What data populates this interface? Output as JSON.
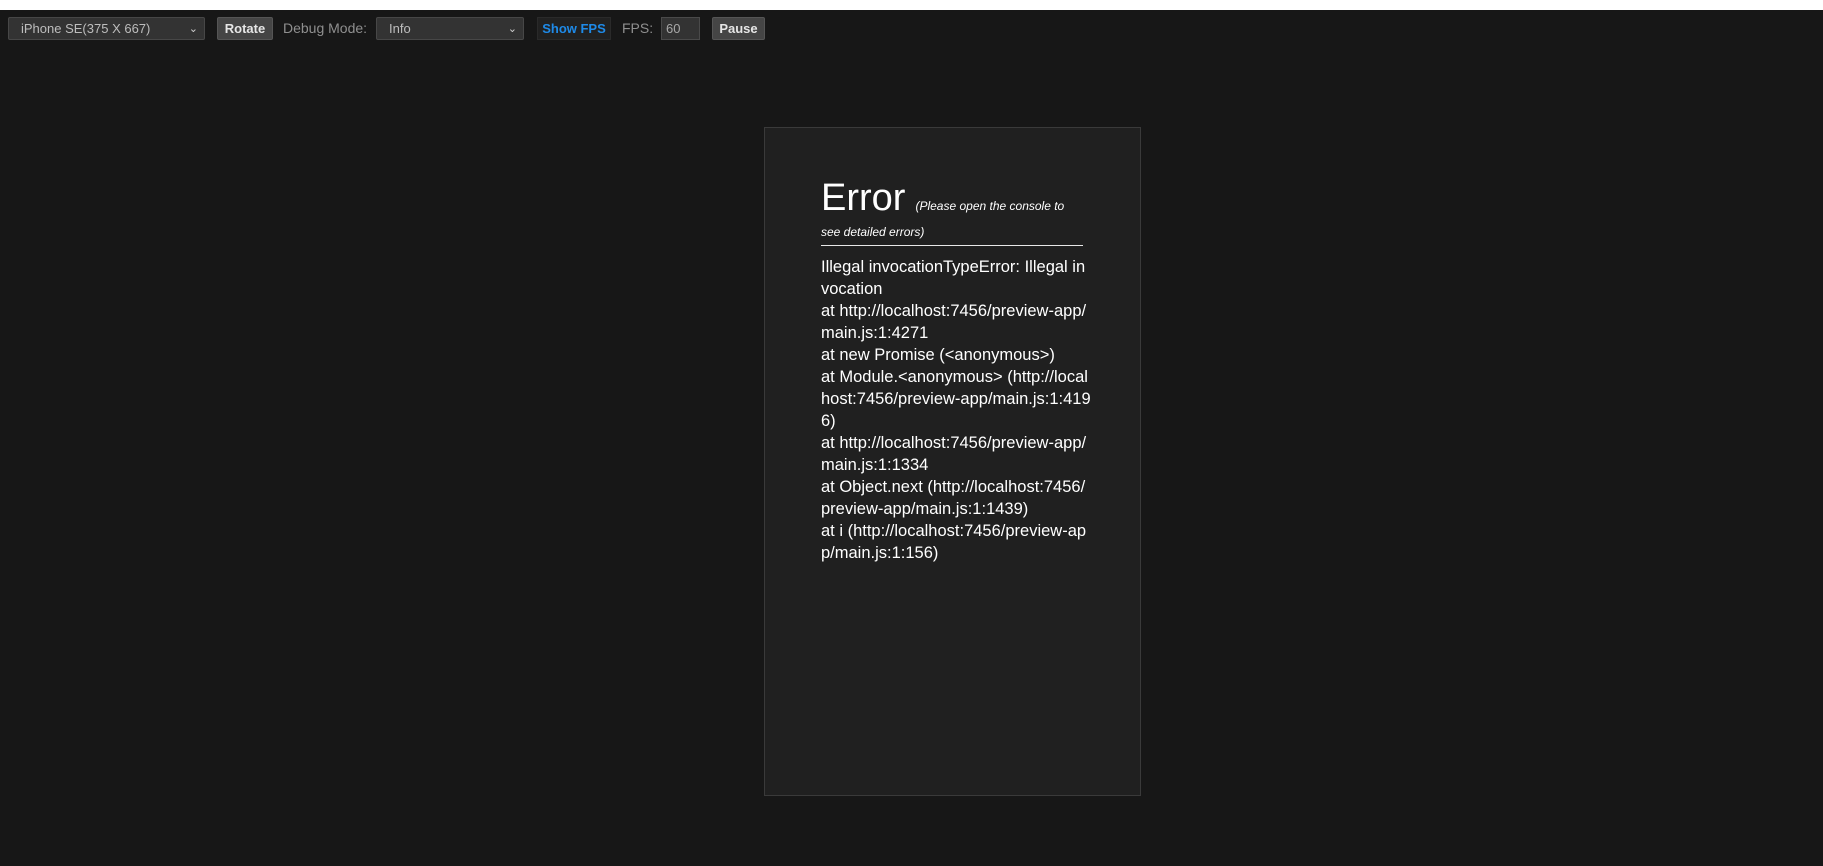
{
  "toolbar": {
    "device_select": "iPhone SE(375 X 667)",
    "rotate_label": "Rotate",
    "debug_mode_label": "Debug Mode:",
    "debug_mode_value": "Info",
    "show_fps_label": "Show FPS",
    "fps_label": "FPS:",
    "fps_value": "60",
    "pause_label": "Pause"
  },
  "error": {
    "title": "Error",
    "note": "(Please open the console to see detailed errors)",
    "message": "Illegal invocationTypeError: Illegal invocation",
    "stack": [
      "at http://localhost:7456/preview-app/main.js:1:4271",
      "at new Promise (<anonymous>)",
      "at Module.<anonymous> (http://localhost:7456/preview-app/main.js:1:4196)",
      "at http://localhost:7456/preview-app/main.js:1:1334",
      "at Object.next (http://localhost:7456/preview-app/main.js:1:1439)",
      "at i (http://localhost:7456/preview-app/main.js:1:156)"
    ]
  },
  "colors": {
    "background": "#171717",
    "device_background": "#202020",
    "accent": "#1e8ae8"
  }
}
